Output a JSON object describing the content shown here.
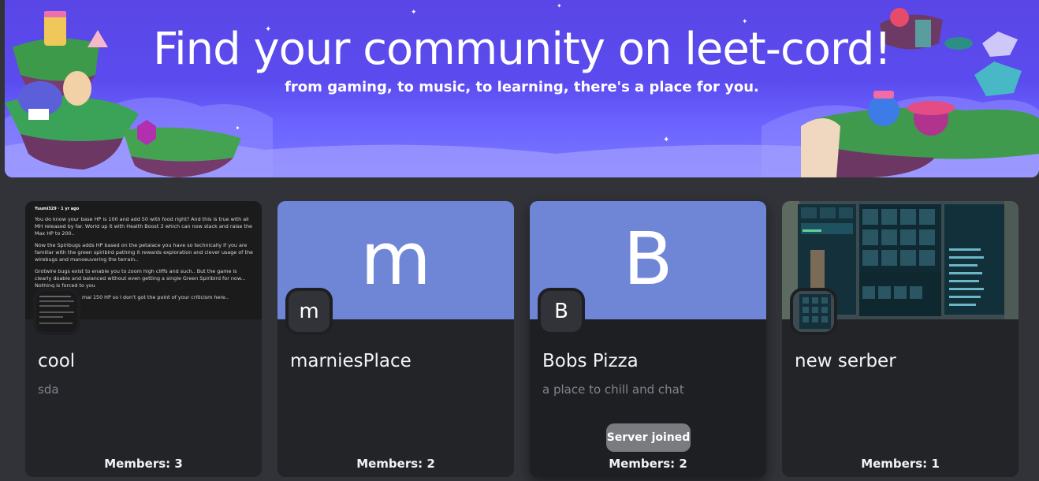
{
  "hero": {
    "title": "Find your community on leet-cord!",
    "subtitle": "from gaming, to music, to learning, there's a place for you."
  },
  "colors": {
    "page_bg": "#313338",
    "card_bg": "#232428",
    "banner_default": "#6f86d6",
    "hero_bg": "#5b4bee"
  },
  "servers": [
    {
      "name": "cool",
      "description": "sda",
      "members_label": "Members: 3",
      "icon_letter": "",
      "banner_letter": "",
      "banner_type": "image-post"
    },
    {
      "name": "marniesPlace",
      "description": "",
      "members_label": "Members: 2",
      "icon_letter": "m",
      "banner_letter": "m",
      "banner_type": "letter"
    },
    {
      "name": "Bobs Pizza",
      "description": "a place to chill and chat",
      "members_label": "Members: 2",
      "icon_letter": "B",
      "banner_letter": "B",
      "banner_type": "letter",
      "status_button": "Server joined"
    },
    {
      "name": "new serber",
      "description": "",
      "members_label": "Members: 1",
      "icon_letter": "",
      "banner_letter": "",
      "banner_type": "image-game"
    }
  ],
  "post_excerpt": {
    "author": "Yuumi329 · 1 yr ago",
    "paragraphs": [
      "You do know your base HP is 100 and add 50 with food right? And this is true with all MH released by far. World up it with Health Boost 3 which can now stack and raise the Max HP to 200..",
      "Now the Spiribugs adds HP based on the petalace you have so technically if you are familiar with the green spiribird pathing it rewards exploration and clever usage of the wirebugs and manoeuvering the terrain..",
      "Grotwire bugs exist to enable you to zoom high cliffs and such.. But the game is clearly doable and balanced without even getting a single Green Spiribird for now... Nothing is forced to you",
      "mal 150 HP so I don't got the point of your criticism here.."
    ]
  }
}
